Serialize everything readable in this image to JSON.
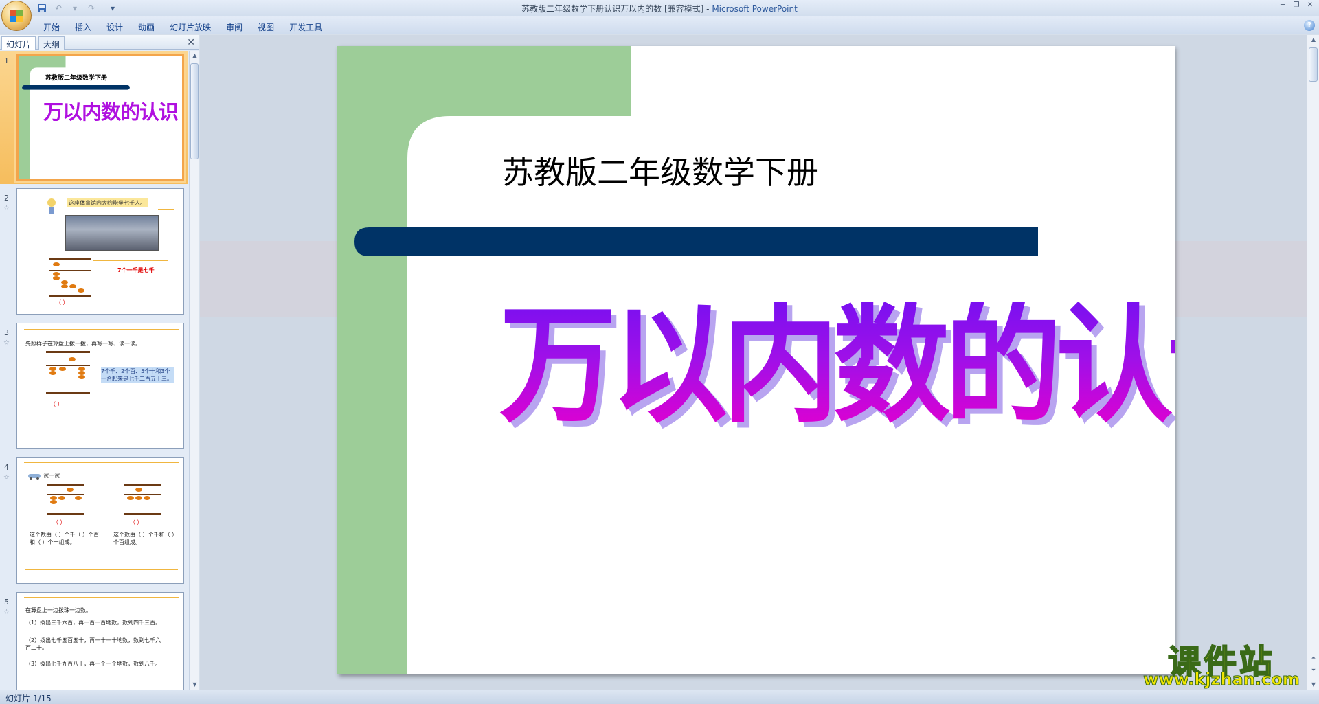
{
  "window": {
    "doc_title": "苏教版二年级数学下册认识万以内的数 [兼容模式]",
    "separator": " - ",
    "app_name": "Microsoft PowerPoint"
  },
  "ribbon": {
    "tabs": [
      "开始",
      "插入",
      "设计",
      "动画",
      "幻灯片放映",
      "审阅",
      "视图",
      "开发工具"
    ]
  },
  "pane": {
    "tab_slides": "幻灯片",
    "tab_outline": "大纲",
    "close": "✕"
  },
  "thumbnails": [
    {
      "num": "1",
      "subtitle": "苏教版二年级数学下册",
      "title": "万以内数的认识"
    },
    {
      "num": "2",
      "caption": "这座体育馆内大约能坐七千人。",
      "label": "7个一千是七千",
      "paren": "（      ）"
    },
    {
      "num": "3",
      "instruction": "先照样子在算盘上拨一拨，再写一写、读一读。",
      "note": "7个千、2个百、5个十和3个一合起来是七千二百五十三。",
      "paren": "（      ）"
    },
    {
      "num": "4",
      "heading": "试一试",
      "paren": "（      ）",
      "left_text": "这个数由（   ）个千（   ）个百和（   ）个十组成。",
      "right_text": "这个数由（   ）个千和（   ）个百组成。"
    },
    {
      "num": "5",
      "heading": "在算盘上一边拨珠一边数。",
      "item1": "（1）拨出三千六百，再一百一百地数，数到四千三百。",
      "item2": "（2）拨出七千五百五十，再一十一十地数，数到七千六百二十。",
      "item3": "（3）拨出七千九百八十，再一个一个地数，数到八千。"
    }
  ],
  "slide": {
    "subtitle": "苏教版二年级数学下册",
    "title": "万以内数的认识"
  },
  "status": {
    "slide_counter": "幻灯片 1/15"
  },
  "watermark": {
    "brand": "课件站",
    "url": "www.kjzhan.com"
  },
  "colors": {
    "green_band": "#9dcd98",
    "navy_bar": "#003366",
    "title_purple": "#9a10e0",
    "title_magenta": "#d000d0"
  }
}
